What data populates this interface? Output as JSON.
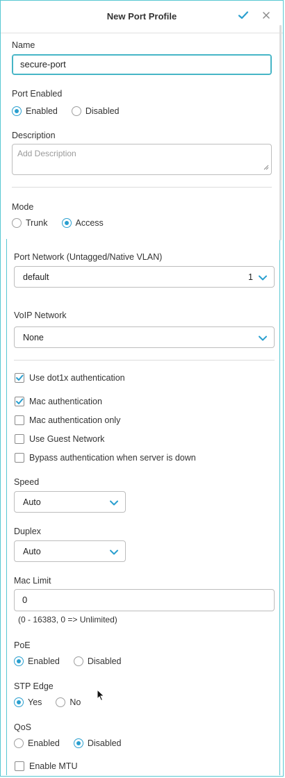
{
  "header": {
    "title": "New Port Profile",
    "check_icon": "checkmark-icon",
    "close_icon": "close-icon"
  },
  "name": {
    "label": "Name",
    "value": "secure-port"
  },
  "port_enabled": {
    "label": "Port Enabled",
    "options": [
      "Enabled",
      "Disabled"
    ],
    "selected": "Enabled"
  },
  "description": {
    "label": "Description",
    "placeholder": "Add Description"
  },
  "mode": {
    "label": "Mode",
    "options": [
      "Trunk",
      "Access"
    ],
    "selected": "Access"
  },
  "port_network": {
    "label": "Port Network (Untagged/Native VLAN)",
    "value": "default",
    "count": "1"
  },
  "voip_network": {
    "label": "VoIP Network",
    "value": "None"
  },
  "auth": {
    "dot1x": {
      "label": "Use dot1x authentication",
      "checked": true
    },
    "options": [
      {
        "label": "Mac authentication",
        "checked": true
      },
      {
        "label": "Mac authentication only",
        "checked": false
      },
      {
        "label": "Use Guest Network",
        "checked": false
      },
      {
        "label": "Bypass authentication when server is down",
        "checked": false
      }
    ]
  },
  "speed": {
    "label": "Speed",
    "value": "Auto"
  },
  "duplex": {
    "label": "Duplex",
    "value": "Auto"
  },
  "mac_limit": {
    "label": "Mac Limit",
    "value": "0",
    "hint": "(0 - 16383, 0 => Unlimited)"
  },
  "poe": {
    "label": "PoE",
    "options": [
      "Enabled",
      "Disabled"
    ],
    "selected": "Enabled"
  },
  "stp_edge": {
    "label": "STP Edge",
    "options": [
      "Yes",
      "No"
    ],
    "selected": "Yes"
  },
  "qos": {
    "label": "QoS",
    "options": [
      "Enabled",
      "Disabled"
    ],
    "selected": "Disabled"
  },
  "mtu": {
    "label": "Enable MTU",
    "checked": false
  },
  "colors": {
    "accent": "#2a9fcf",
    "focus_border": "#46b5c6",
    "frame": "#58c7d2"
  }
}
